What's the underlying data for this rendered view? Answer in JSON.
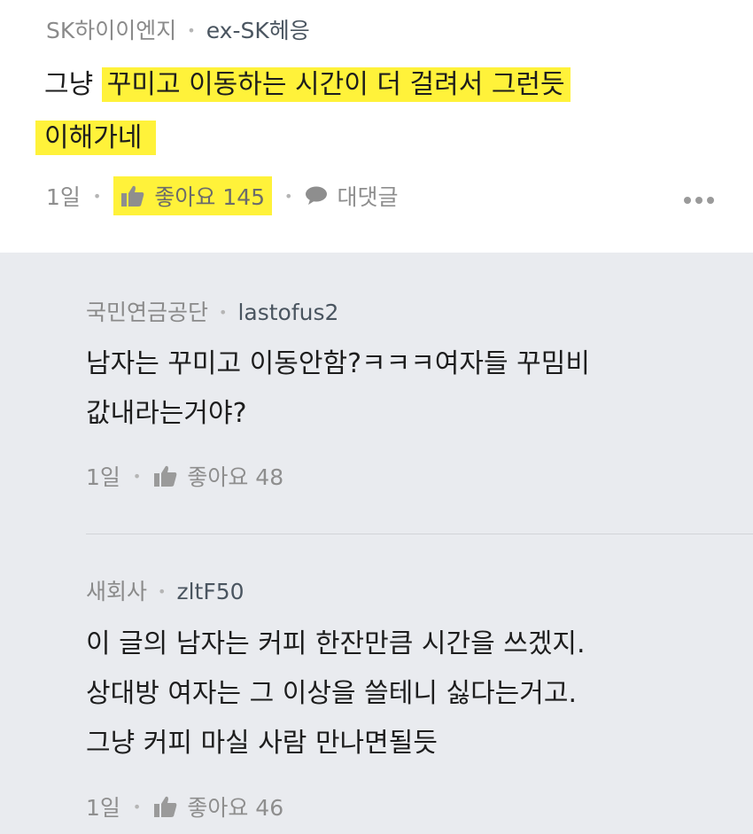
{
  "post": {
    "company": "SK하이이엔지",
    "nickname": "ex-SK헤응",
    "body_plain": "그냥 ",
    "body_highlight_1": "꾸미고 이동하는 시간이 더 걸려서 그런듯",
    "body_highlight_2": "이해가네",
    "time": "1일",
    "like_label": "좋아요 145",
    "reply_label": "대댓글"
  },
  "replies": [
    {
      "company": "국민연금공단",
      "nickname": "lastofus2",
      "lines": [
        "남자는 꾸미고 이동안함?ㅋㅋㅋ여자들 꾸밈비",
        "값내라는거야?"
      ],
      "time": "1일",
      "like_label": "좋아요 48"
    },
    {
      "company": "새회사",
      "nickname": "zltF50",
      "lines": [
        "이 글의 남자는 커피 한잔만큼 시간을 쓰겠지.",
        "상대방 여자는 그 이상을 쓸테니 싫다는거고.",
        "그냥 커피 마실 사람 만나면될듯"
      ],
      "time": "1일",
      "like_label": "좋아요 46"
    }
  ],
  "colors": {
    "highlight": "#fff23a",
    "reply_background": "#e9ebef"
  },
  "icons": {
    "like": "thumbs-up-icon",
    "reply": "speech-bubble-icon",
    "more": "more-dots-icon"
  }
}
